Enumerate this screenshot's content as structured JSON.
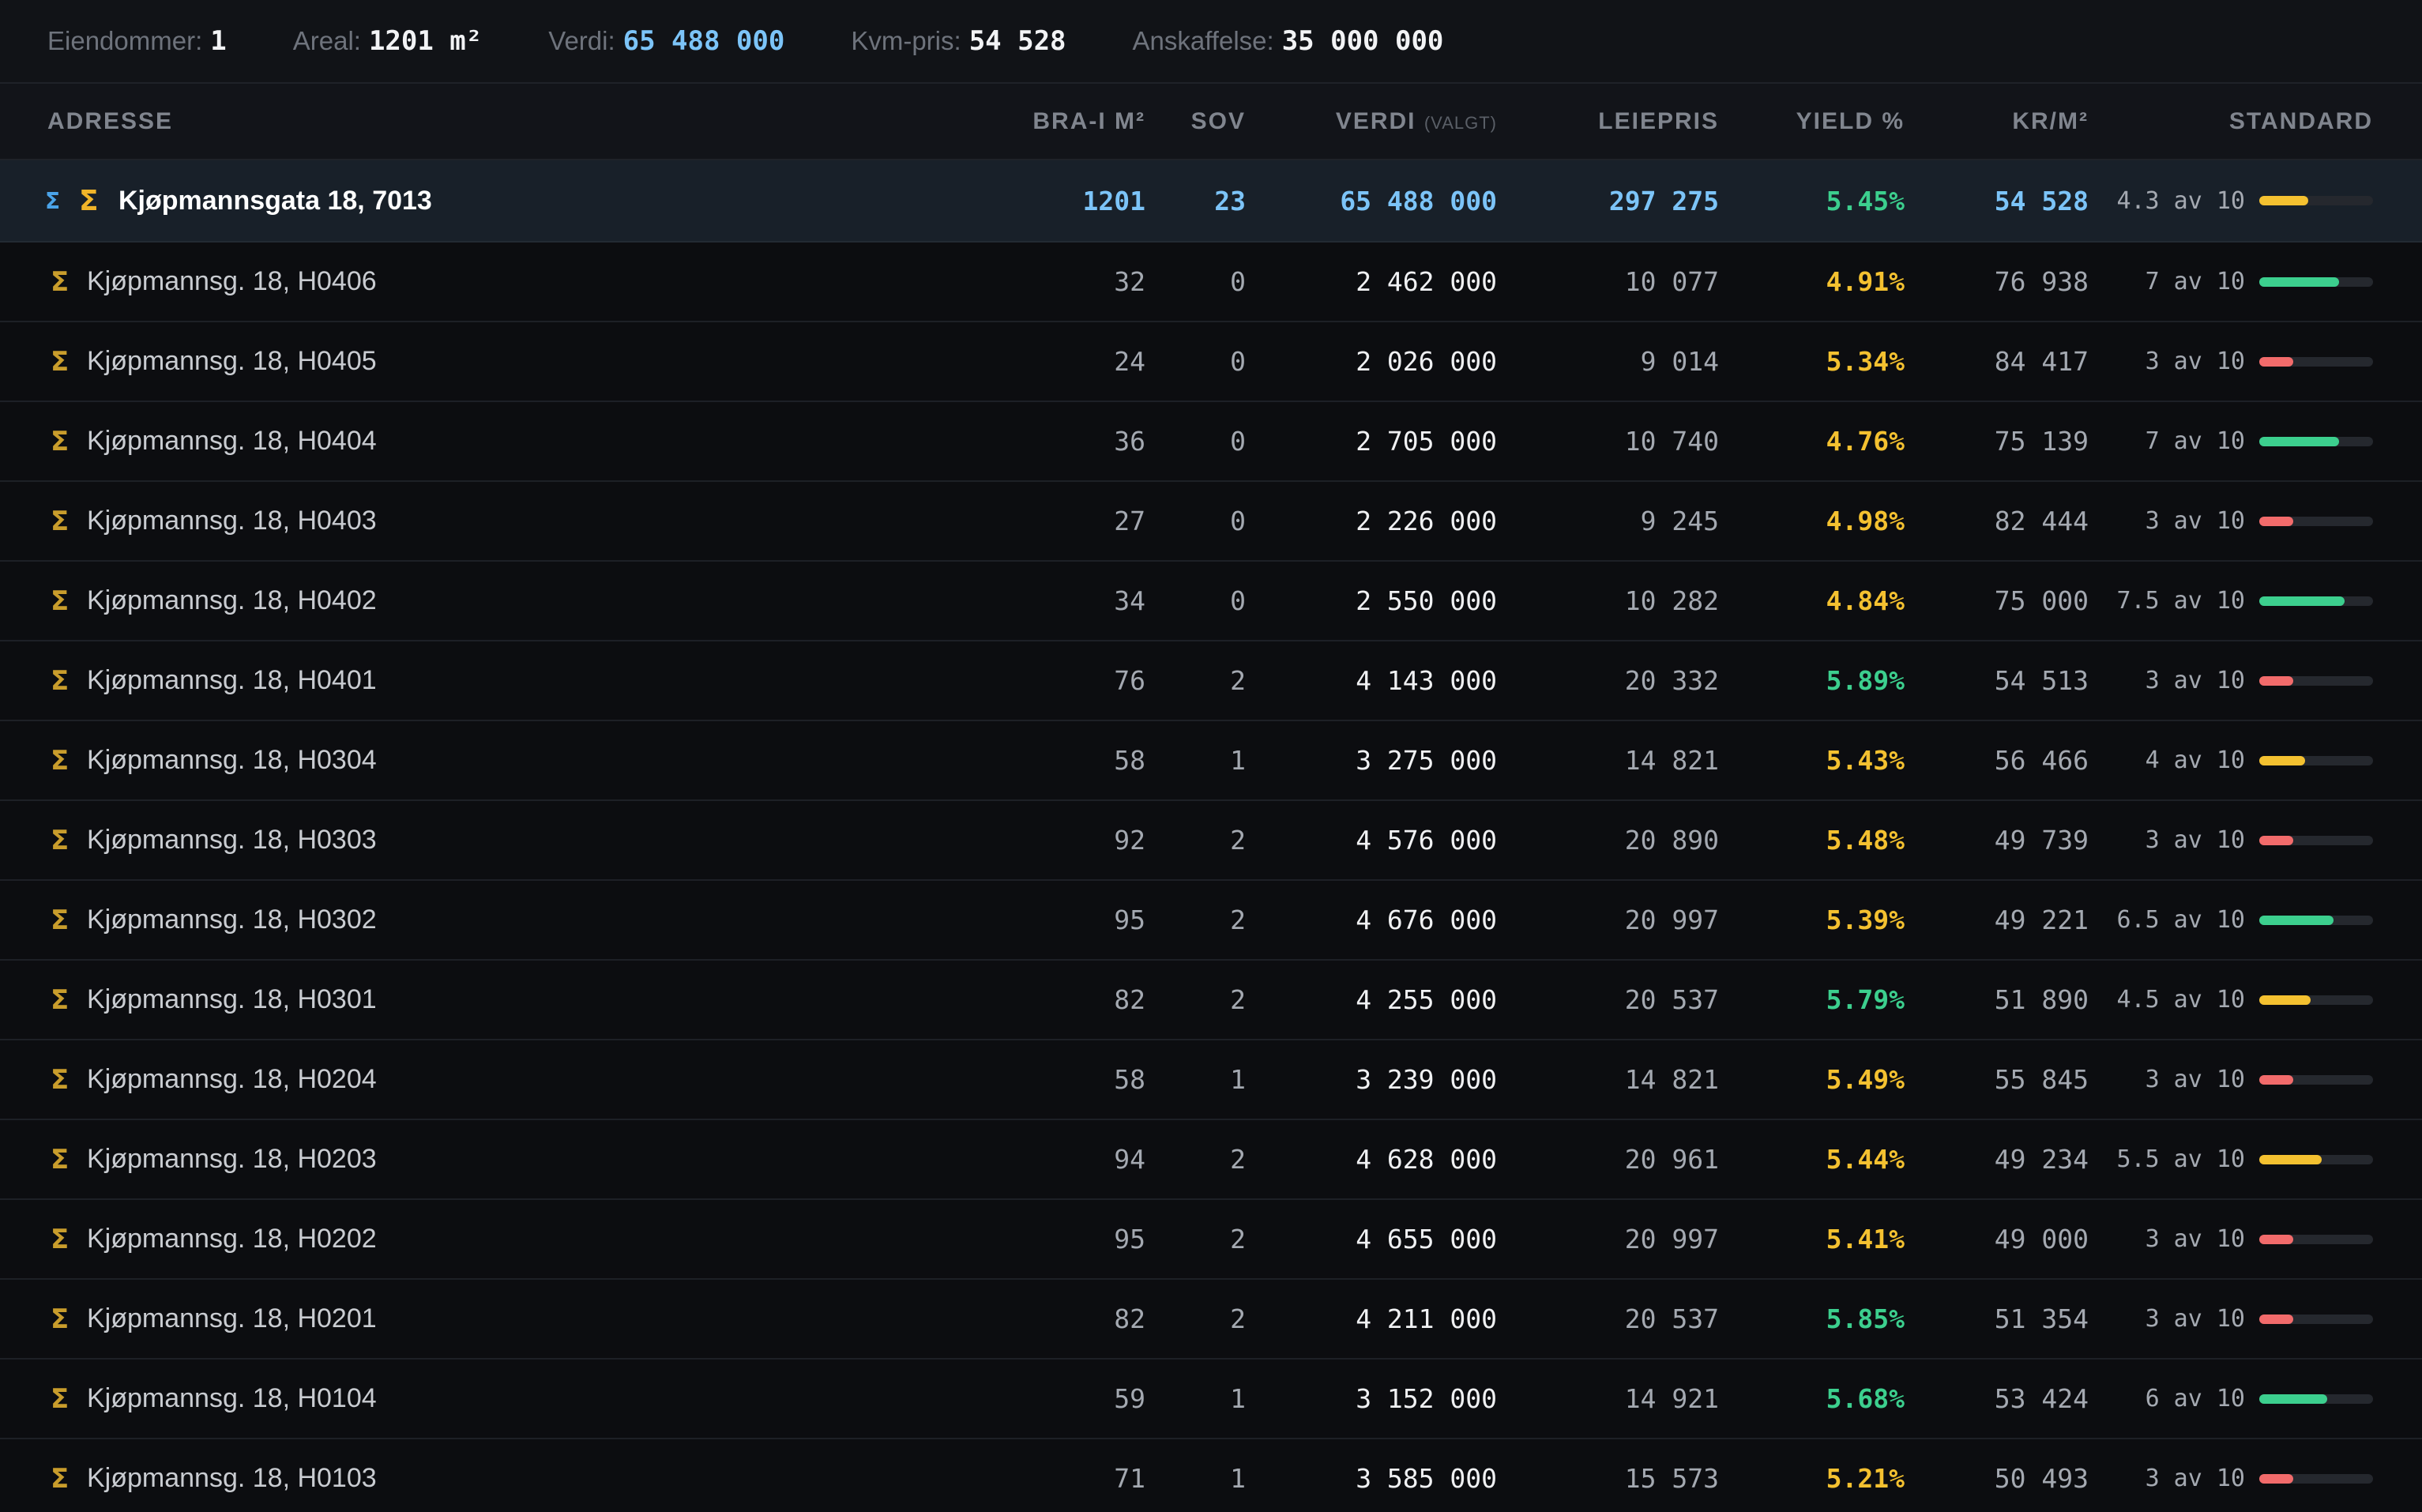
{
  "stats": [
    {
      "label": "Eiendommer",
      "value": "1",
      "accent": false
    },
    {
      "label": "Areal",
      "value": "1201 m²",
      "accent": false
    },
    {
      "label": "Verdi",
      "value": "65 488 000",
      "accent": true
    },
    {
      "label": "Kvm-pris",
      "value": "54 528",
      "accent": false
    },
    {
      "label": "Anskaffelse",
      "value": "35 000 000",
      "accent": false
    }
  ],
  "columns": {
    "adresse": "ADRESSE",
    "bra": "BRA-I M²",
    "sov": "SOV",
    "verdi": "VERDI",
    "verdi_suffix": "(VALGT)",
    "leiepris": "LEIEPRIS",
    "yield": "YIELD %",
    "krm2": "KR/M²",
    "standard": "STANDARD"
  },
  "summary": {
    "address": "Kjøpmannsgata 18, 7013",
    "bra": "1201",
    "sov": "23",
    "verdi": "65 488 000",
    "leiepris": "297 275",
    "yield": "5.45%",
    "krm2": "54 528",
    "standard_text": "4.3 av 10",
    "standard_value": 4.3,
    "standard_color": "#f4c130"
  },
  "rows": [
    {
      "address": "Kjøpmannsg. 18, H0406",
      "bra": "32",
      "sov": "0",
      "verdi": "2 462 000",
      "leiepris": "10 077",
      "yield": "4.91%",
      "yield_color": "yellow",
      "krm2": "76 938",
      "standard_text": "7 av 10",
      "standard_value": 7,
      "standard_color": "#3ccf8e"
    },
    {
      "address": "Kjøpmannsg. 18, H0405",
      "bra": "24",
      "sov": "0",
      "verdi": "2 026 000",
      "leiepris": "9 014",
      "yield": "5.34%",
      "yield_color": "yellow",
      "krm2": "84 417",
      "standard_text": "3 av 10",
      "standard_value": 3,
      "standard_color": "#f26b6b"
    },
    {
      "address": "Kjøpmannsg. 18, H0404",
      "bra": "36",
      "sov": "0",
      "verdi": "2 705 000",
      "leiepris": "10 740",
      "yield": "4.76%",
      "yield_color": "yellow",
      "krm2": "75 139",
      "standard_text": "7 av 10",
      "standard_value": 7,
      "standard_color": "#3ccf8e"
    },
    {
      "address": "Kjøpmannsg. 18, H0403",
      "bra": "27",
      "sov": "0",
      "verdi": "2 226 000",
      "leiepris": "9 245",
      "yield": "4.98%",
      "yield_color": "yellow",
      "krm2": "82 444",
      "standard_text": "3 av 10",
      "standard_value": 3,
      "standard_color": "#f26b6b"
    },
    {
      "address": "Kjøpmannsg. 18, H0402",
      "bra": "34",
      "sov": "0",
      "verdi": "2 550 000",
      "leiepris": "10 282",
      "yield": "4.84%",
      "yield_color": "yellow",
      "krm2": "75 000",
      "standard_text": "7.5 av 10",
      "standard_value": 7.5,
      "standard_color": "#3ccf8e"
    },
    {
      "address": "Kjøpmannsg. 18, H0401",
      "bra": "76",
      "sov": "2",
      "verdi": "4 143 000",
      "leiepris": "20 332",
      "yield": "5.89%",
      "yield_color": "green",
      "krm2": "54 513",
      "standard_text": "3 av 10",
      "standard_value": 3,
      "standard_color": "#f26b6b"
    },
    {
      "address": "Kjøpmannsg. 18, H0304",
      "bra": "58",
      "sov": "1",
      "verdi": "3 275 000",
      "leiepris": "14 821",
      "yield": "5.43%",
      "yield_color": "yellow",
      "krm2": "56 466",
      "standard_text": "4 av 10",
      "standard_value": 4,
      "standard_color": "#f4c130"
    },
    {
      "address": "Kjøpmannsg. 18, H0303",
      "bra": "92",
      "sov": "2",
      "verdi": "4 576 000",
      "leiepris": "20 890",
      "yield": "5.48%",
      "yield_color": "yellow",
      "krm2": "49 739",
      "standard_text": "3 av 10",
      "standard_value": 3,
      "standard_color": "#f26b6b"
    },
    {
      "address": "Kjøpmannsg. 18, H0302",
      "bra": "95",
      "sov": "2",
      "verdi": "4 676 000",
      "leiepris": "20 997",
      "yield": "5.39%",
      "yield_color": "yellow",
      "krm2": "49 221",
      "standard_text": "6.5 av 10",
      "standard_value": 6.5,
      "standard_color": "#3ccf8e"
    },
    {
      "address": "Kjøpmannsg. 18, H0301",
      "bra": "82",
      "sov": "2",
      "verdi": "4 255 000",
      "leiepris": "20 537",
      "yield": "5.79%",
      "yield_color": "green",
      "krm2": "51 890",
      "standard_text": "4.5 av 10",
      "standard_value": 4.5,
      "standard_color": "#f4c130"
    },
    {
      "address": "Kjøpmannsg. 18, H0204",
      "bra": "58",
      "sov": "1",
      "verdi": "3 239 000",
      "leiepris": "14 821",
      "yield": "5.49%",
      "yield_color": "yellow",
      "krm2": "55 845",
      "standard_text": "3 av 10",
      "standard_value": 3,
      "standard_color": "#f26b6b"
    },
    {
      "address": "Kjøpmannsg. 18, H0203",
      "bra": "94",
      "sov": "2",
      "verdi": "4 628 000",
      "leiepris": "20 961",
      "yield": "5.44%",
      "yield_color": "yellow",
      "krm2": "49 234",
      "standard_text": "5.5 av 10",
      "standard_value": 5.5,
      "standard_color": "#f4c130"
    },
    {
      "address": "Kjøpmannsg. 18, H0202",
      "bra": "95",
      "sov": "2",
      "verdi": "4 655 000",
      "leiepris": "20 997",
      "yield": "5.41%",
      "yield_color": "yellow",
      "krm2": "49 000",
      "standard_text": "3 av 10",
      "standard_value": 3,
      "standard_color": "#f26b6b"
    },
    {
      "address": "Kjøpmannsg. 18, H0201",
      "bra": "82",
      "sov": "2",
      "verdi": "4 211 000",
      "leiepris": "20 537",
      "yield": "5.85%",
      "yield_color": "green",
      "krm2": "51 354",
      "standard_text": "3 av 10",
      "standard_value": 3,
      "standard_color": "#f26b6b"
    },
    {
      "address": "Kjøpmannsg. 18, H0104",
      "bra": "59",
      "sov": "1",
      "verdi": "3 152 000",
      "leiepris": "14 921",
      "yield": "5.68%",
      "yield_color": "green",
      "krm2": "53 424",
      "standard_text": "6 av 10",
      "standard_value": 6,
      "standard_color": "#3ccf8e"
    },
    {
      "address": "Kjøpmannsg. 18, H0103",
      "bra": "71",
      "sov": "1",
      "verdi": "3 585 000",
      "leiepris": "15 573",
      "yield": "5.21%",
      "yield_color": "yellow",
      "krm2": "50 493",
      "standard_text": "3 av 10",
      "standard_value": 3,
      "standard_color": "#f26b6b"
    }
  ],
  "icons": {
    "sigma_symbol": "Σ",
    "expand_icon": "sigma-blue-icon",
    "group_icon": "sigma-gold-icon"
  }
}
